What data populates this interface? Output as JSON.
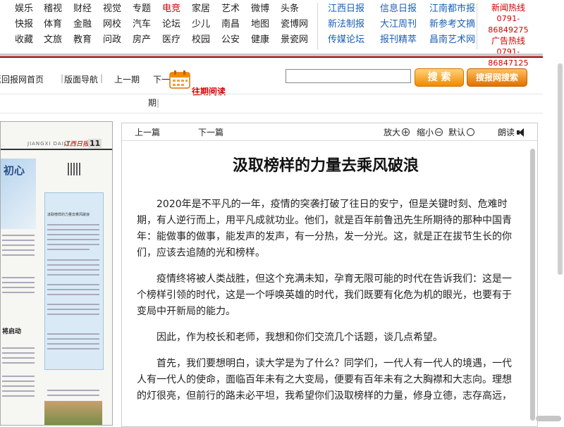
{
  "nav": {
    "rows": [
      [
        {
          "label": "娱乐"
        },
        {
          "label": "稽视"
        },
        {
          "label": "财经"
        },
        {
          "label": "视觉"
        },
        {
          "label": "专题"
        },
        {
          "label": "电竞",
          "highlight": true
        },
        {
          "label": "家居"
        },
        {
          "label": "艺术"
        },
        {
          "label": "微博"
        },
        {
          "label": "头条"
        }
      ],
      [
        {
          "label": "快报"
        },
        {
          "label": "体育"
        },
        {
          "label": "金融"
        },
        {
          "label": "网校"
        },
        {
          "label": "汽车"
        },
        {
          "label": "论坛"
        },
        {
          "label": "少儿"
        },
        {
          "label": "南昌"
        },
        {
          "label": "地图"
        },
        {
          "label": "瓷博网"
        }
      ],
      [
        {
          "label": "收藏"
        },
        {
          "label": "文旅"
        },
        {
          "label": "教育"
        },
        {
          "label": "问政"
        },
        {
          "label": "房产"
        },
        {
          "label": "医疗"
        },
        {
          "label": "校园"
        },
        {
          "label": "公安"
        },
        {
          "label": "健康"
        },
        {
          "label": "景瓷网"
        }
      ]
    ],
    "papers": [
      [
        "江西日报",
        "信息日报",
        "江南都市报"
      ],
      [
        "新法制报",
        "大江周刊",
        "新参考文摘"
      ],
      [
        "传媒论坛",
        "报刊精萃",
        "昌南艺术网"
      ]
    ],
    "hotline": {
      "news_label": "新闻热线",
      "news_phone": "0791-86849275",
      "ad_label": "广告热线",
      "ad_phone": "0791-86847125"
    }
  },
  "toolbar": {
    "back_home": "返回报网首页",
    "layout_nav": "版面导航",
    "prev_issue": "上一期",
    "next_issue": "下一期",
    "past_reading": "往期阅读",
    "search_value": "",
    "search_btn": "搜 索",
    "search_site_btn": "搜报网搜索",
    "period": "期"
  },
  "paper_thumb": {
    "masthead_en": "JIANGXI DAILY",
    "masthead": "江西日报",
    "page_num": "11",
    "headline_left": "初心",
    "column_title": "汲取榜样的力量去乘风破浪",
    "headline_lower": "将启动"
  },
  "article": {
    "prev": "上一篇",
    "next": "下一篇",
    "zoom_in": "放大",
    "zoom_out": "缩小",
    "default": "默认",
    "read_aloud": "朗读",
    "title": "汲取榜样的力量去乘风破浪",
    "paragraphs": [
      "2020年是不平凡的一年，疫情的突袭打破了往日的安宁，但是关键时刻、危难时期，有人逆行而上，用平凡成就功业。他们，就是百年前鲁迅先生所期待的那种中国青年：能做事的做事，能发声的发声，有一分热，发一分光。这，就是正在拔节生长的你们，应该去追随的光和榜样。",
      "疫情终将被人类战胜，但这个充满未知，孕育无限可能的时代在告诉我们：这是一个榜样引领的时代，这是一个呼唤英雄的时代，我们既要有化危为机的眼光，也要有于变局中开新局的能力。",
      "因此，作为校长和老师，我想和你们交流几个话题，谈几点希望。",
      "首先，我们要想明白，读大学是为了什么？同学们，一代人有一代人的境遇，一代人有一代人的使命，面临百年未有之大变局，便要有百年未有之大胸襟和大志向。理想的灯很亮，但前行的路未必平坦，我希望你们汲取榜样的力量，修身立德，志存高远，"
    ]
  },
  "colors": {
    "accent_red": "#d00000",
    "link_blue": "#1a5fb4",
    "search_orange": "#f08a00"
  }
}
